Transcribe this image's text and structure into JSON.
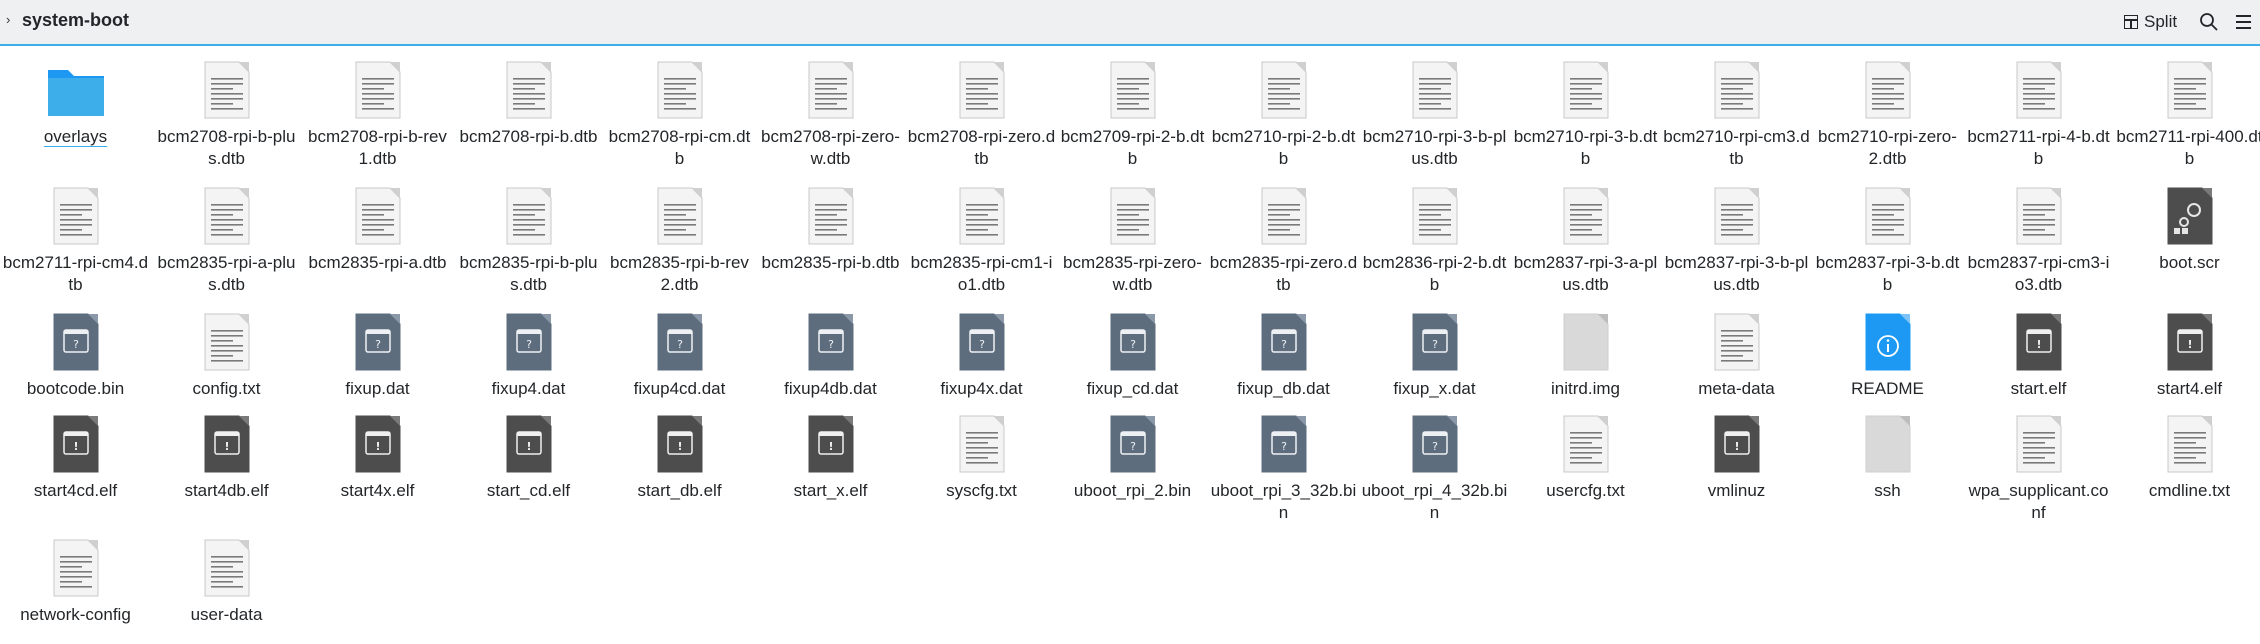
{
  "header": {
    "breadcrumb_arrow": "›",
    "title": "system-boot",
    "split_label": "Split"
  },
  "colors": {
    "accent": "#3daee9",
    "toolbar_bg": "#eff0f1",
    "folder": "#3daee9",
    "binary_icon": "#5d6d7e",
    "exec_icon": "#4d4d4d",
    "readme_icon": "#1d99f3"
  },
  "files": [
    {
      "name": "overlays",
      "type": "folder"
    },
    {
      "name": "bcm2708-rpi-b-plus.dtb",
      "type": "text"
    },
    {
      "name": "bcm2708-rpi-b-rev1.dtb",
      "type": "text"
    },
    {
      "name": "bcm2708-rpi-b.dtb",
      "type": "text"
    },
    {
      "name": "bcm2708-rpi-cm.dtb",
      "type": "text"
    },
    {
      "name": "bcm2708-rpi-zero-w.dtb",
      "type": "text"
    },
    {
      "name": "bcm2708-rpi-zero.dtb",
      "type": "text"
    },
    {
      "name": "bcm2709-rpi-2-b.dtb",
      "type": "text"
    },
    {
      "name": "bcm2710-rpi-2-b.dtb",
      "type": "text"
    },
    {
      "name": "bcm2710-rpi-3-b-plus.dtb",
      "type": "text"
    },
    {
      "name": "bcm2710-rpi-3-b.dtb",
      "type": "text"
    },
    {
      "name": "bcm2710-rpi-cm3.dtb",
      "type": "text"
    },
    {
      "name": "bcm2710-rpi-zero-2.dtb",
      "type": "text"
    },
    {
      "name": "bcm2711-rpi-4-b.dtb",
      "type": "text"
    },
    {
      "name": "bcm2711-rpi-400.dtb",
      "type": "text"
    },
    {
      "name": "bcm2711-rpi-cm4.dtb",
      "type": "text"
    },
    {
      "name": "bcm2835-rpi-a-plus.dtb",
      "type": "text"
    },
    {
      "name": "bcm2835-rpi-a.dtb",
      "type": "text"
    },
    {
      "name": "bcm2835-rpi-b-plus.dtb",
      "type": "text"
    },
    {
      "name": "bcm2835-rpi-b-rev2.dtb",
      "type": "text"
    },
    {
      "name": "bcm2835-rpi-b.dtb",
      "type": "text"
    },
    {
      "name": "bcm2835-rpi-cm1-io1.dtb",
      "type": "text"
    },
    {
      "name": "bcm2835-rpi-zero-w.dtb",
      "type": "text"
    },
    {
      "name": "bcm2835-rpi-zero.dtb",
      "type": "text"
    },
    {
      "name": "bcm2836-rpi-2-b.dtb",
      "type": "text"
    },
    {
      "name": "bcm2837-rpi-3-a-plus.dtb",
      "type": "text"
    },
    {
      "name": "bcm2837-rpi-3-b-plus.dtb",
      "type": "text"
    },
    {
      "name": "bcm2837-rpi-3-b.dtb",
      "type": "text"
    },
    {
      "name": "bcm2837-rpi-cm3-io3.dtb",
      "type": "text"
    },
    {
      "name": "boot.scr",
      "type": "script"
    },
    {
      "name": "bootcode.bin",
      "type": "binary"
    },
    {
      "name": "config.txt",
      "type": "text"
    },
    {
      "name": "fixup.dat",
      "type": "binary"
    },
    {
      "name": "fixup4.dat",
      "type": "binary"
    },
    {
      "name": "fixup4cd.dat",
      "type": "binary"
    },
    {
      "name": "fixup4db.dat",
      "type": "binary"
    },
    {
      "name": "fixup4x.dat",
      "type": "binary"
    },
    {
      "name": "fixup_cd.dat",
      "type": "binary"
    },
    {
      "name": "fixup_db.dat",
      "type": "binary"
    },
    {
      "name": "fixup_x.dat",
      "type": "binary"
    },
    {
      "name": "initrd.img",
      "type": "blank"
    },
    {
      "name": "meta-data",
      "type": "text"
    },
    {
      "name": "README",
      "type": "readme"
    },
    {
      "name": "start.elf",
      "type": "exec"
    },
    {
      "name": "start4.elf",
      "type": "exec"
    },
    {
      "name": "start4cd.elf",
      "type": "exec"
    },
    {
      "name": "start4db.elf",
      "type": "exec"
    },
    {
      "name": "start4x.elf",
      "type": "exec"
    },
    {
      "name": "start_cd.elf",
      "type": "exec"
    },
    {
      "name": "start_db.elf",
      "type": "exec"
    },
    {
      "name": "start_x.elf",
      "type": "exec"
    },
    {
      "name": "syscfg.txt",
      "type": "text"
    },
    {
      "name": "uboot_rpi_2.bin",
      "type": "binary"
    },
    {
      "name": "uboot_rpi_3_32b.bin",
      "type": "binary"
    },
    {
      "name": "uboot_rpi_4_32b.bin",
      "type": "binary"
    },
    {
      "name": "usercfg.txt",
      "type": "text"
    },
    {
      "name": "vmlinuz",
      "type": "exec"
    },
    {
      "name": "ssh",
      "type": "blank"
    },
    {
      "name": "wpa_supplicant.conf",
      "type": "text"
    },
    {
      "name": "cmdline.txt",
      "type": "text"
    },
    {
      "name": "network-config",
      "type": "text"
    },
    {
      "name": "user-data",
      "type": "text"
    }
  ]
}
